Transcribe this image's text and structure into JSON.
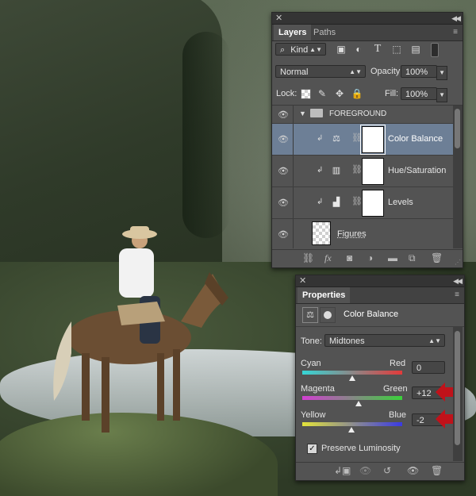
{
  "layers_panel": {
    "tabs": [
      "Layers",
      "Paths"
    ],
    "filter_kind": "Kind",
    "blend_mode": "Normal",
    "opacity_label": "Opacity:",
    "opacity_value": "100%",
    "lock_label": "Lock:",
    "fill_label": "Fill:",
    "fill_value": "100%",
    "layers": [
      {
        "name": "FOREGROUND",
        "type": "group"
      },
      {
        "name": "Color Balance",
        "type": "adjustment",
        "selected": true
      },
      {
        "name": "Hue/Saturation",
        "type": "adjustment"
      },
      {
        "name": "Levels",
        "type": "adjustment"
      },
      {
        "name": "Figures",
        "type": "pixel"
      }
    ]
  },
  "properties_panel": {
    "tab": "Properties",
    "adjustment_name": "Color Balance",
    "tone_label": "Tone:",
    "tone_value": "Midtones",
    "sliders": [
      {
        "left": "Cyan",
        "right": "Red",
        "value": "0",
        "fraction": 0.5
      },
      {
        "left": "Magenta",
        "right": "Green",
        "value": "+12",
        "fraction": 0.56
      },
      {
        "left": "Yellow",
        "right": "Blue",
        "value": "-2",
        "fraction": 0.49
      }
    ],
    "preserve_luminosity_label": "Preserve Luminosity",
    "preserve_luminosity_checked": true
  },
  "colors": {
    "panel_bg": "#535353",
    "selected_row": "#6d7f96",
    "annotation_arrow": "#c0121a"
  }
}
